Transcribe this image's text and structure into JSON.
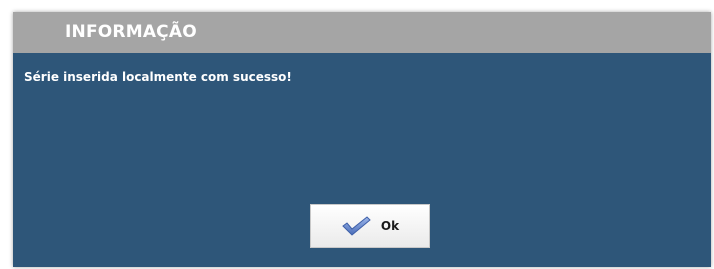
{
  "dialog": {
    "title": "INFORMAÇÃO",
    "message": "Série inserida localmente com sucesso!",
    "ok_label": "Ok"
  },
  "colors": {
    "titlebar": "#a5a5a5",
    "body": "#2e5679",
    "text": "#ffffff",
    "checkmark": "#5b7fc7"
  },
  "icons": {
    "ok": "checkmark-icon"
  }
}
